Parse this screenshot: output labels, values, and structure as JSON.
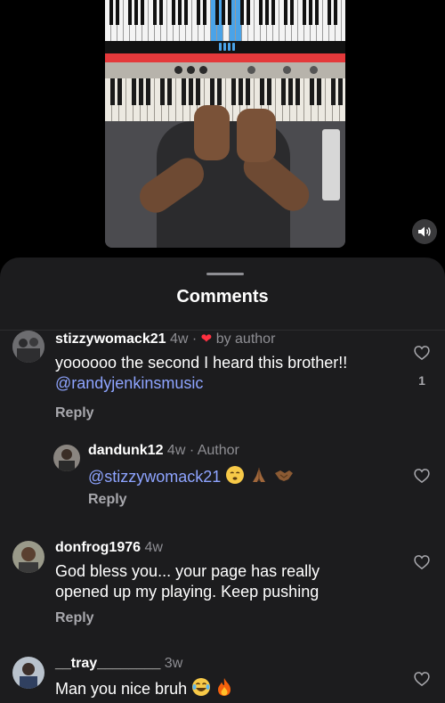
{
  "sheet": {
    "title": "Comments"
  },
  "comments": [
    {
      "username": "stizzywomack21",
      "time": "4w",
      "separator": "·",
      "liked_by_author": "by author",
      "text": "yoooooo the second I heard this brother!!",
      "mention": "@randyjenkinsmusic",
      "reply_label": "Reply",
      "like_count": "1"
    },
    {
      "username": "dandunk12",
      "time": "4w",
      "separator": "·",
      "role": "Author",
      "mention": "@stizzywomack21",
      "reply_label": "Reply"
    },
    {
      "username": "donfrog1976",
      "time": "4w",
      "text_line1": "God bless you... your page has really",
      "text_line2": "opened up my playing. Keep pushing",
      "reply_label": "Reply"
    },
    {
      "username": "__tray________",
      "time": "3w",
      "text": "Man you nice bruh"
    }
  ],
  "icons": {
    "sound": "speaker-icon",
    "like": "heart-outline-icon",
    "author_like": "heart-filled-icon"
  },
  "colors": {
    "sheet_bg": "#1c1c1e",
    "mention": "#8ea4ff",
    "author_heart": "#ff3040"
  }
}
